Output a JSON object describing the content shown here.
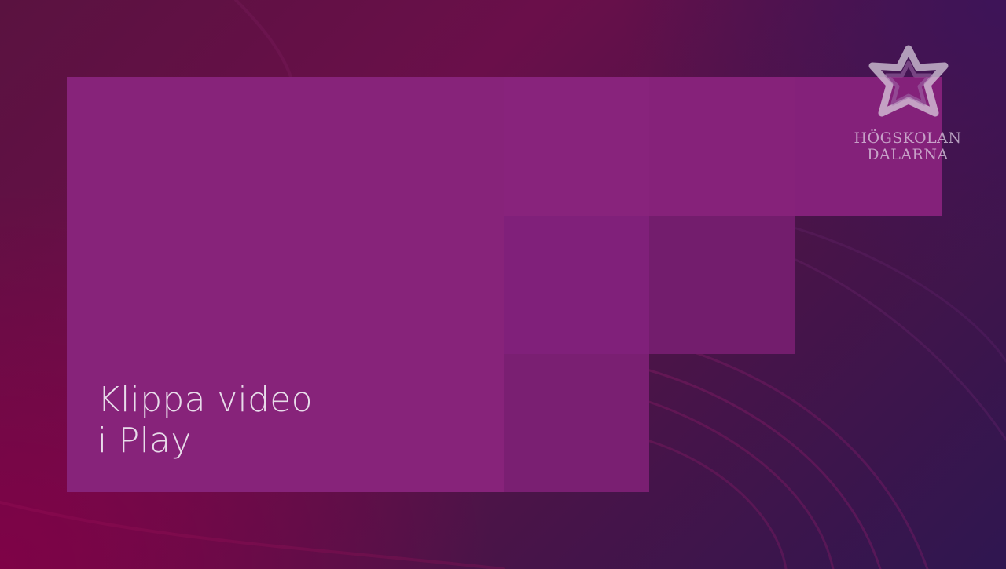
{
  "slide": {
    "title_line1": "Klippa video",
    "title_line2": "i Play"
  },
  "logo": {
    "line1": "HÖGSKOLAN",
    "line2": "DALARNA"
  },
  "colors": {
    "panel": "#87237a",
    "background_dark": "#2f1650",
    "background_magenta": "#6a0f4a",
    "text": "#e8dcea"
  }
}
